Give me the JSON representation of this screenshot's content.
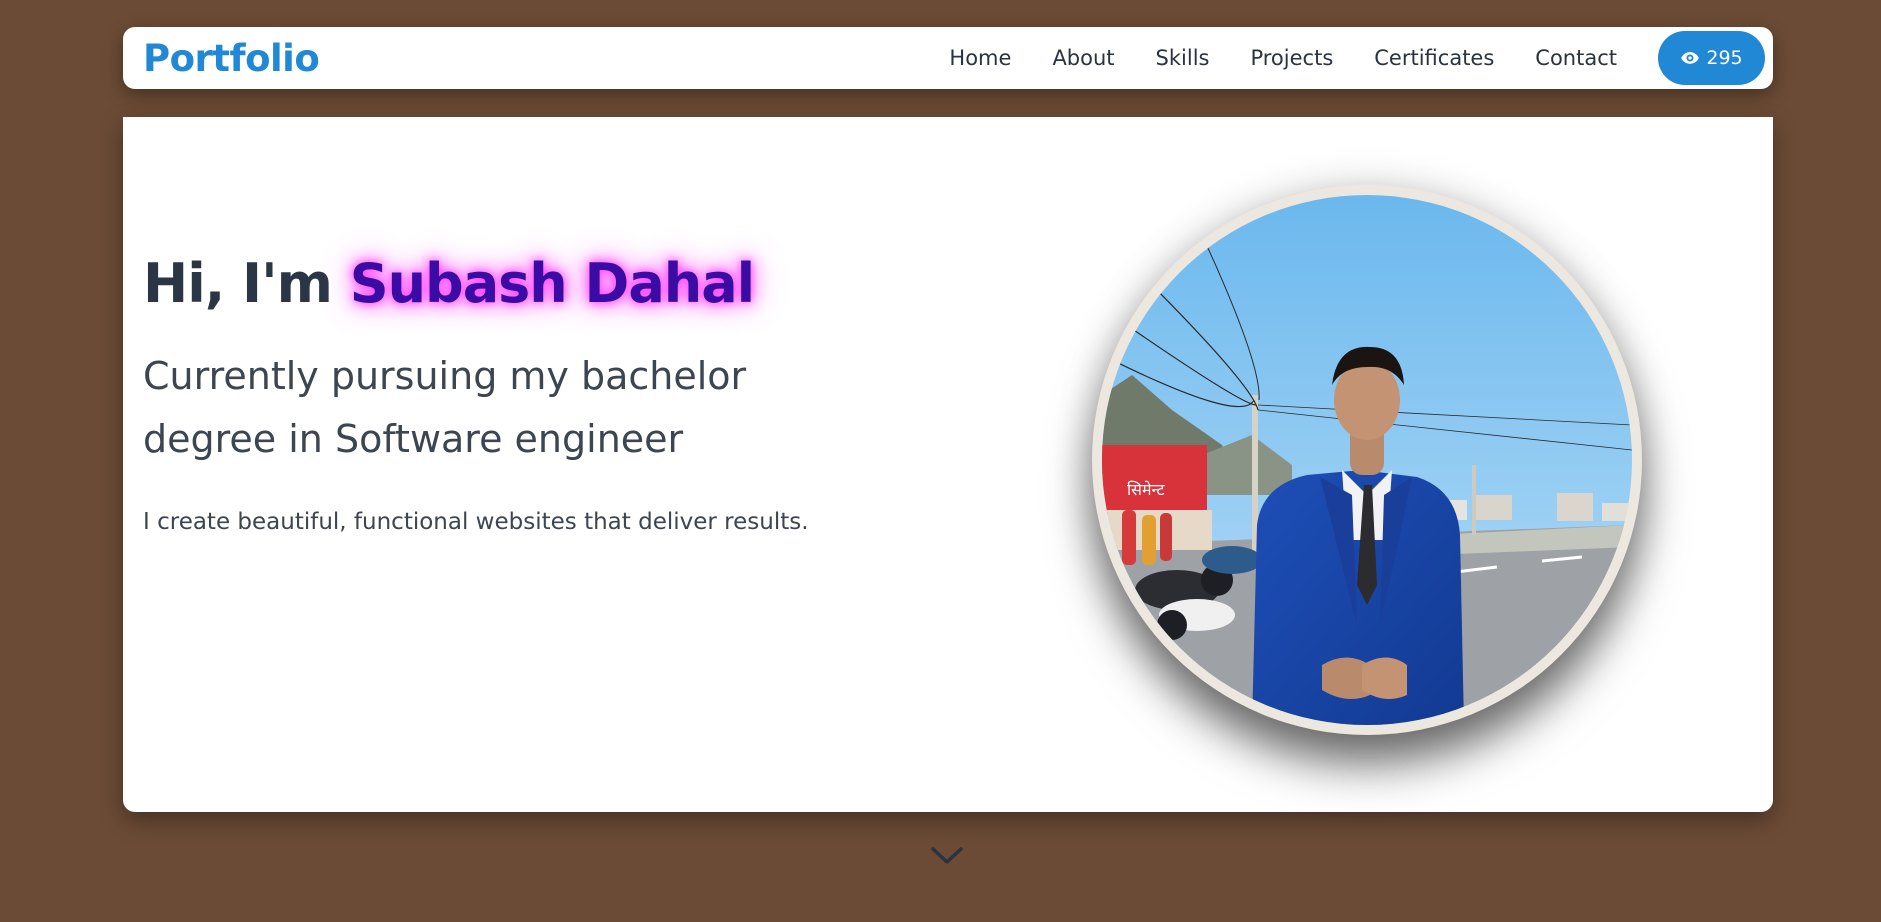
{
  "navbar": {
    "brand": "Portfolio",
    "links": [
      "Home",
      "About",
      "Skills",
      "Projects",
      "Certificates",
      "Contact"
    ],
    "view_count": "295",
    "view_icon": "eye-icon"
  },
  "hero": {
    "greeting_prefix": "Hi, I'm ",
    "name": "Subash Dahal",
    "subtitle": "Currently pursuing my bachelor degree in Software engineer",
    "tagline": "I create beautiful, functional websites that deliver results.",
    "sign_text": "सिमेन्ट"
  },
  "scroll_icon": "chevron-down-icon",
  "colors": {
    "background": "#6b4b35",
    "accent": "#2188d6",
    "name_text": "#3a0ca3",
    "name_glow": "#ff33ff"
  }
}
